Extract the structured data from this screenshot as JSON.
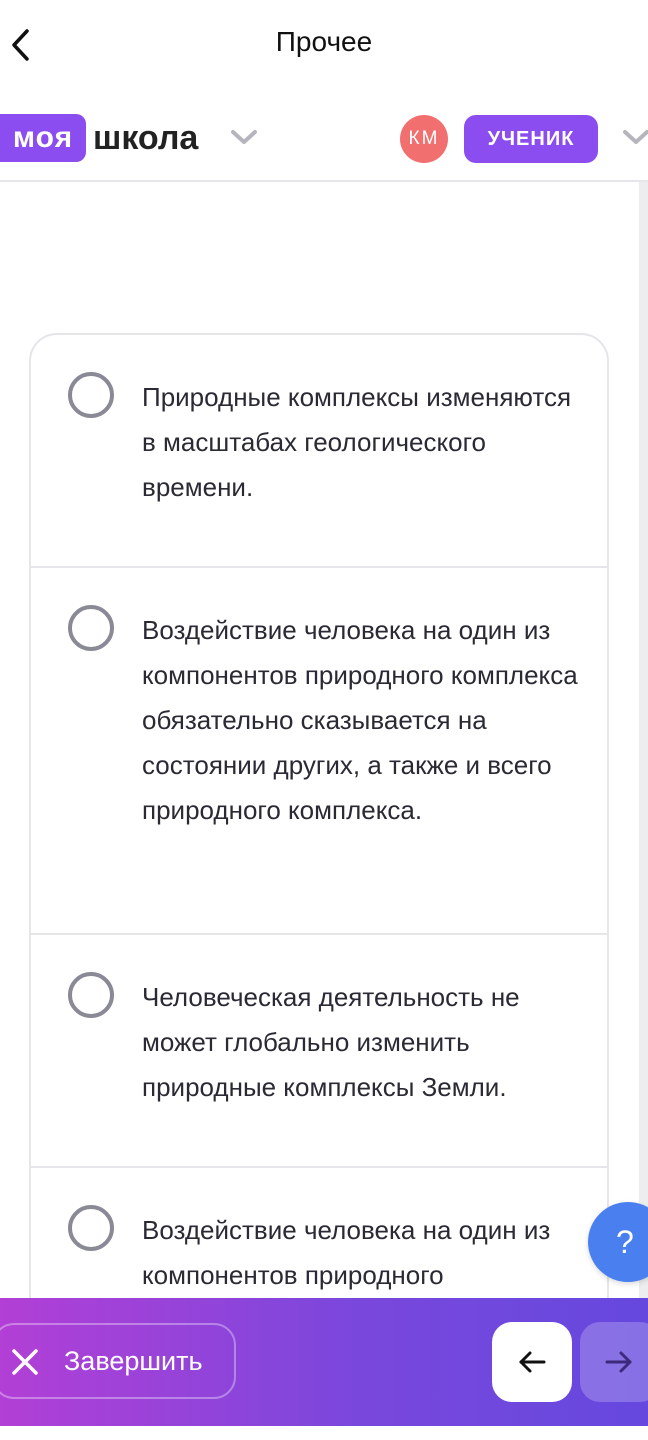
{
  "topbar": {
    "title": "Прочее",
    "back_icon": "chevron-left-icon"
  },
  "header": {
    "logo_part1": "моя",
    "logo_part2": "школа",
    "avatar_initials": "КМ",
    "role": "УЧЕНИК",
    "brand_color": "#8b4cf0",
    "avatar_color": "#f26f6f"
  },
  "options": [
    {
      "text": "Природные комплексы изменяются в масштабах геологического времени.",
      "selected": false
    },
    {
      "text": "Воздействие человека на один из компонентов природного комплекса обязательно сказывается на состоянии других, а также и всего природного комплекса.",
      "selected": false
    },
    {
      "text": "Человеческая деятельность не может глобально изменить природные комплексы Земли.",
      "selected": false
    },
    {
      "text": "Воздействие человека на один из компонентов природного",
      "selected": false
    }
  ],
  "help_button": {
    "label": "?",
    "color": "#4a7ff0"
  },
  "bottombar": {
    "finish_label": "Завершить",
    "prev_icon": "arrow-left-icon",
    "next_icon": "arrow-right-icon"
  }
}
